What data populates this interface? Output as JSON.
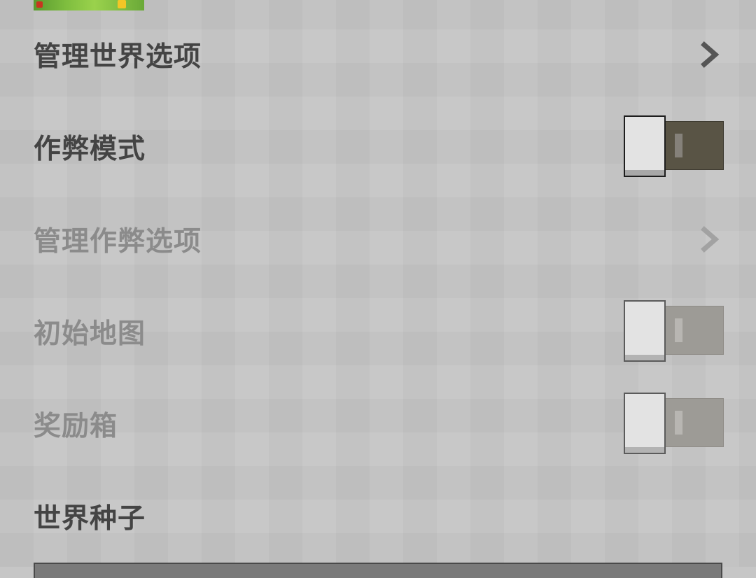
{
  "colors": {
    "background": "#c6c6c6",
    "text_enabled": "#444444",
    "text_disabled": "#8b8b8b",
    "toggle_track": "#595445",
    "toggle_track_disabled": "#9d9b96",
    "toggle_knob": "#e3e3e3"
  },
  "menu": {
    "manage_world_options": {
      "label": "管理世界选项",
      "icon": "chevron-right-icon"
    },
    "cheats_mode": {
      "label": "作弊模式",
      "state": "off",
      "enabled": true
    },
    "manage_cheat_options": {
      "label": "管理作弊选项",
      "icon": "chevron-right-icon",
      "enabled": false
    },
    "starting_map": {
      "label": "初始地图",
      "state": "off",
      "enabled": false
    },
    "bonus_chest": {
      "label": "奖励箱",
      "state": "off",
      "enabled": false
    },
    "world_seed": {
      "label": "世界种子",
      "value": ""
    }
  }
}
